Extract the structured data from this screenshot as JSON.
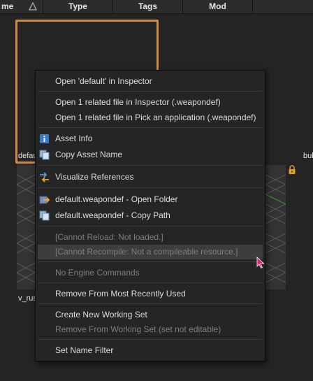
{
  "header": {
    "col_name": "me",
    "col_type": "Type",
    "col_tags": "Tags",
    "col_mod": "Mod"
  },
  "assets": {
    "label_1": "defau",
    "label_2": "v_rus",
    "label_3": "bul"
  },
  "menu": {
    "items": [
      {
        "label": "Open 'default' in Inspector"
      },
      {
        "label": "Open 1 related file in Inspector (.weapondef)"
      },
      {
        "label": "Open 1 related file in Pick an application (.weapondef)"
      },
      {
        "label": "Asset Info",
        "icon": "info-icon"
      },
      {
        "label": "Copy Asset Name",
        "icon": "copy-icon"
      },
      {
        "label": "Visualize References",
        "icon": "references-icon"
      },
      {
        "label": "default.weapondef - Open Folder",
        "icon": "open-folder-icon"
      },
      {
        "label": "default.weapondef - Copy Path",
        "icon": "copy-path-icon"
      },
      {
        "label": "[Cannot Reload: Not loaded.]"
      },
      {
        "label": "[Cannot Recompile: Not a compileable resource.]"
      },
      {
        "label": "No Engine Commands"
      },
      {
        "label": "Remove From Most Recently Used"
      },
      {
        "label": "Create New Working Set"
      },
      {
        "label": "Remove From Working Set (set not editable)"
      },
      {
        "label": "Set Name Filter"
      }
    ]
  },
  "colors": {
    "selection": "#d08b45",
    "menu_bg": "#252525",
    "info_icon": "#3b79c4",
    "hover_bg": "#3d3d3d"
  }
}
